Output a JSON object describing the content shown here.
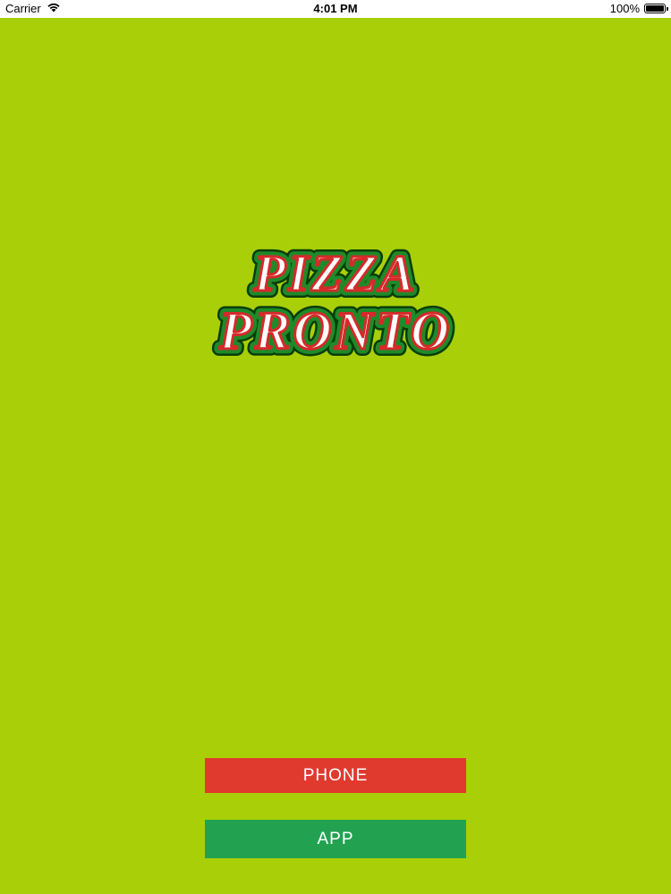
{
  "status_bar": {
    "carrier": "Carrier",
    "time": "4:01 PM",
    "battery_text": "100%",
    "battery_level": 1.0
  },
  "logo": {
    "line1": "PIZZA",
    "line2": "PRONTO"
  },
  "buttons": {
    "phone_label": "PHONE",
    "app_label": "APP"
  },
  "colors": {
    "background": "#a9cf08",
    "phone_button": "#e03a2e",
    "app_button": "#22a251",
    "logo_green": "#1f8a2a",
    "logo_red": "#d42a2a"
  },
  "icons": {
    "wifi": "wifi-icon",
    "battery": "battery-icon"
  }
}
